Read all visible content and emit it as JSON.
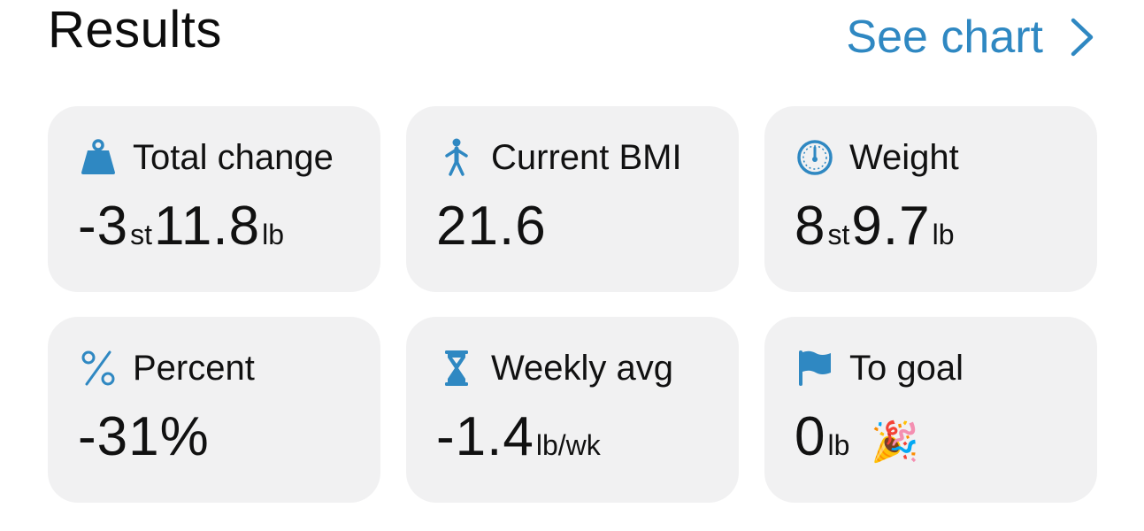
{
  "header": {
    "title": "Results",
    "see_chart_label": "See chart"
  },
  "colors": {
    "accent": "#2f88c2",
    "card_bg": "#f1f1f2",
    "text": "#111111"
  },
  "cards": {
    "total_change": {
      "label": "Total change",
      "icon": "weight-kettlebell-icon",
      "value_big_1": "-3",
      "unit_1": "st",
      "value_big_2": "11.8",
      "unit_2": "lb"
    },
    "current_bmi": {
      "label": "Current BMI",
      "icon": "person-icon",
      "value_big_1": "21.6"
    },
    "weight": {
      "label": "Weight",
      "icon": "gauge-icon",
      "value_big_1": "8",
      "unit_1": "st",
      "value_big_2": "9.7",
      "unit_2": "lb"
    },
    "percent": {
      "label": "Percent",
      "icon": "percent-icon",
      "value_big_1": "-31%"
    },
    "weekly_avg": {
      "label": "Weekly avg",
      "icon": "hourglass-icon",
      "value_big_1": "-1.4",
      "unit_1": "lb/wk"
    },
    "to_goal": {
      "label": "To goal",
      "icon": "flag-icon",
      "value_big_1": "0",
      "unit_1": "lb",
      "emoji": "🎉"
    }
  }
}
